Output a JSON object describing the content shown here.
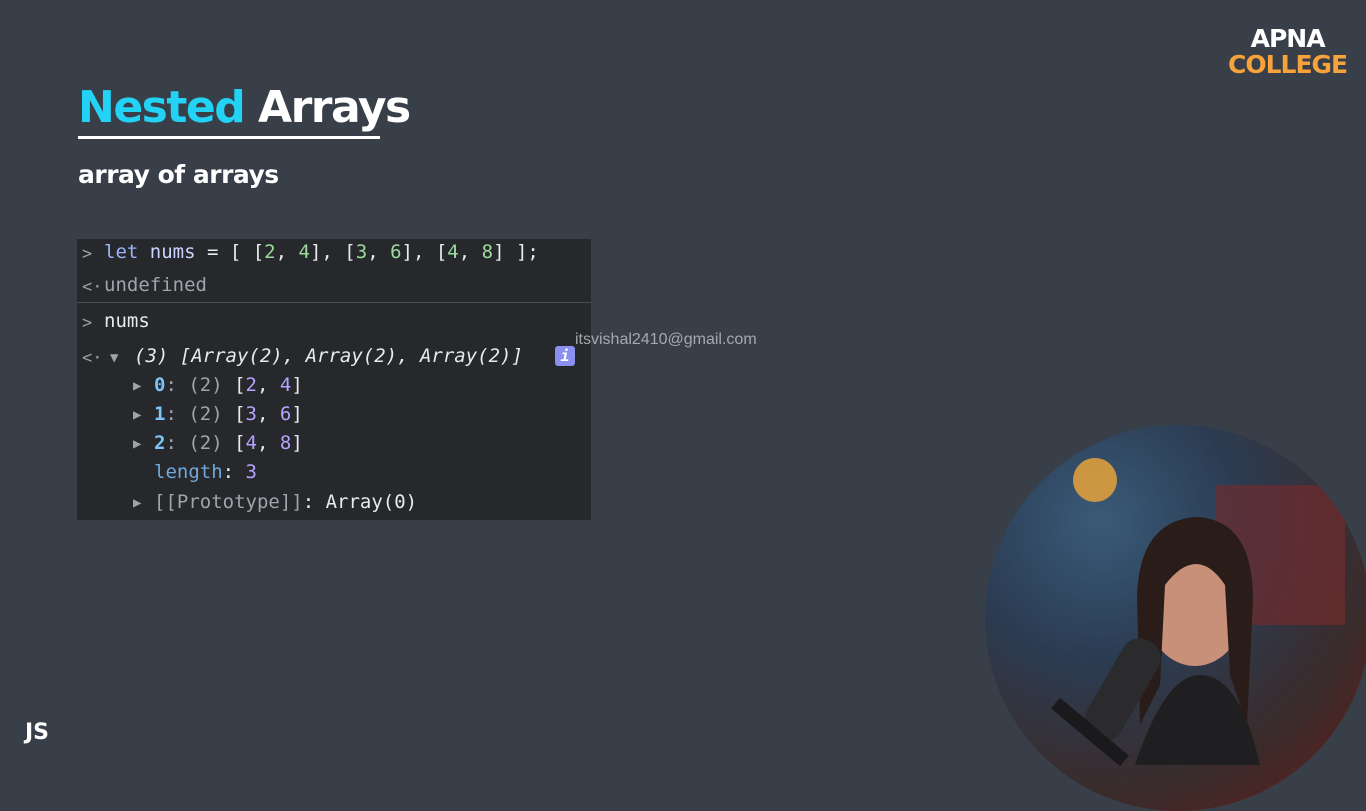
{
  "slide": {
    "title_highlight": "Nested",
    "title_rest": " Arrays",
    "subtitle": "array of arrays",
    "corner_label": "JS"
  },
  "logo": {
    "line1": "APNA",
    "line2": "COLLEGE"
  },
  "watermark": "itsvishal2410@gmail.com",
  "console": {
    "line1": {
      "kw": "let",
      "var": " nums",
      "rest_a": " = [ [",
      "n1": "2",
      "c1": ", ",
      "n2": "4",
      "rest_b": "], [",
      "n3": "3",
      "c2": ", ",
      "n4": "6",
      "rest_c": "], [",
      "n5": "4",
      "c3": ", ",
      "n6": "8",
      "rest_d": "] ];"
    },
    "line2": "undefined",
    "line3": "nums",
    "line4": {
      "count": "(3)",
      "summary": " [Array(2), Array(2), Array(2)]"
    },
    "items": [
      {
        "key": "0",
        "meta": ": (2) ",
        "open": "[",
        "a": "2",
        "sep": ", ",
        "b": "4",
        "close": "]"
      },
      {
        "key": "1",
        "meta": ": (2) ",
        "open": "[",
        "a": "3",
        "sep": ", ",
        "b": "6",
        "close": "]"
      },
      {
        "key": "2",
        "meta": ": (2) ",
        "open": "[",
        "a": "4",
        "sep": ", ",
        "b": "8",
        "close": "]"
      }
    ],
    "length_key": "length",
    "length_colon": ": ",
    "length_val": "3",
    "proto_key": "[[Prototype]]",
    "proto_val": ": Array(0)",
    "info_icon": "i"
  },
  "colors": {
    "background": "#383f49",
    "accent": "#22d3f5",
    "logo_accent": "#f7a23a",
    "console_bg": "#26282c"
  }
}
